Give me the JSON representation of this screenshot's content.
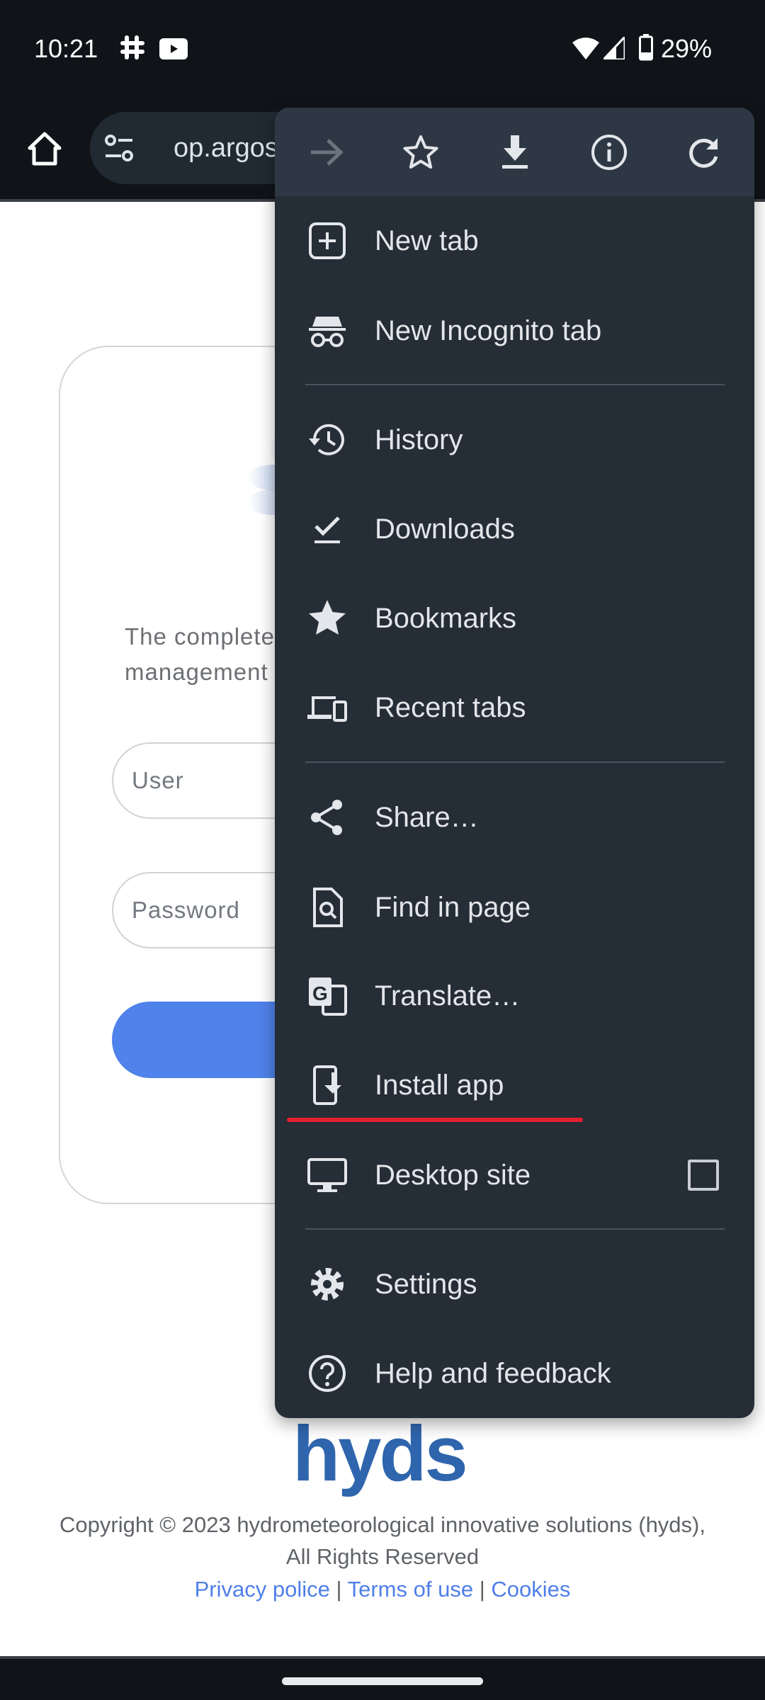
{
  "status_bar": {
    "time": "10:21",
    "battery": "29%",
    "icons": [
      "slack-icon",
      "youtube-icon",
      "wifi-icon",
      "signal-icon",
      "battery-icon"
    ]
  },
  "toolbar": {
    "url": "op.argos-e"
  },
  "page": {
    "tagline_line1": "The complete",
    "tagline_line2": "management",
    "user_placeholder": "User",
    "password_placeholder": "Password",
    "logo": "hyds",
    "copyright_line1": "Copyright © 2023 hydrometeorological innovative solutions (hyds),",
    "copyright_line2": "All Rights Reserved",
    "links": [
      "Privacy police",
      "Terms of use",
      "Cookies"
    ],
    "separator": "|",
    "accent": "#4f82ea"
  },
  "menu": {
    "top_icons": [
      "forward-icon",
      "bookmark-star-icon",
      "download-icon",
      "info-icon",
      "reload-icon"
    ],
    "items": [
      {
        "label": "New tab",
        "icon": "new-tab-icon"
      },
      {
        "label": "New Incognito tab",
        "icon": "incognito-icon"
      },
      {
        "label": "History",
        "icon": "history-icon"
      },
      {
        "label": "Downloads",
        "icon": "downloads-icon"
      },
      {
        "label": "Bookmarks",
        "icon": "bookmarks-icon"
      },
      {
        "label": "Recent tabs",
        "icon": "devices-icon"
      },
      {
        "label": "Share…",
        "icon": "share-icon"
      },
      {
        "label": "Find in page",
        "icon": "find-icon"
      },
      {
        "label": "Translate…",
        "icon": "translate-icon"
      },
      {
        "label": "Install app",
        "icon": "install-app-icon"
      },
      {
        "label": "Desktop site",
        "icon": "desktop-icon",
        "checked": false
      },
      {
        "label": "Settings",
        "icon": "settings-icon"
      },
      {
        "label": "Help and feedback",
        "icon": "help-icon"
      }
    ],
    "highlight_color": "#e5202e"
  }
}
